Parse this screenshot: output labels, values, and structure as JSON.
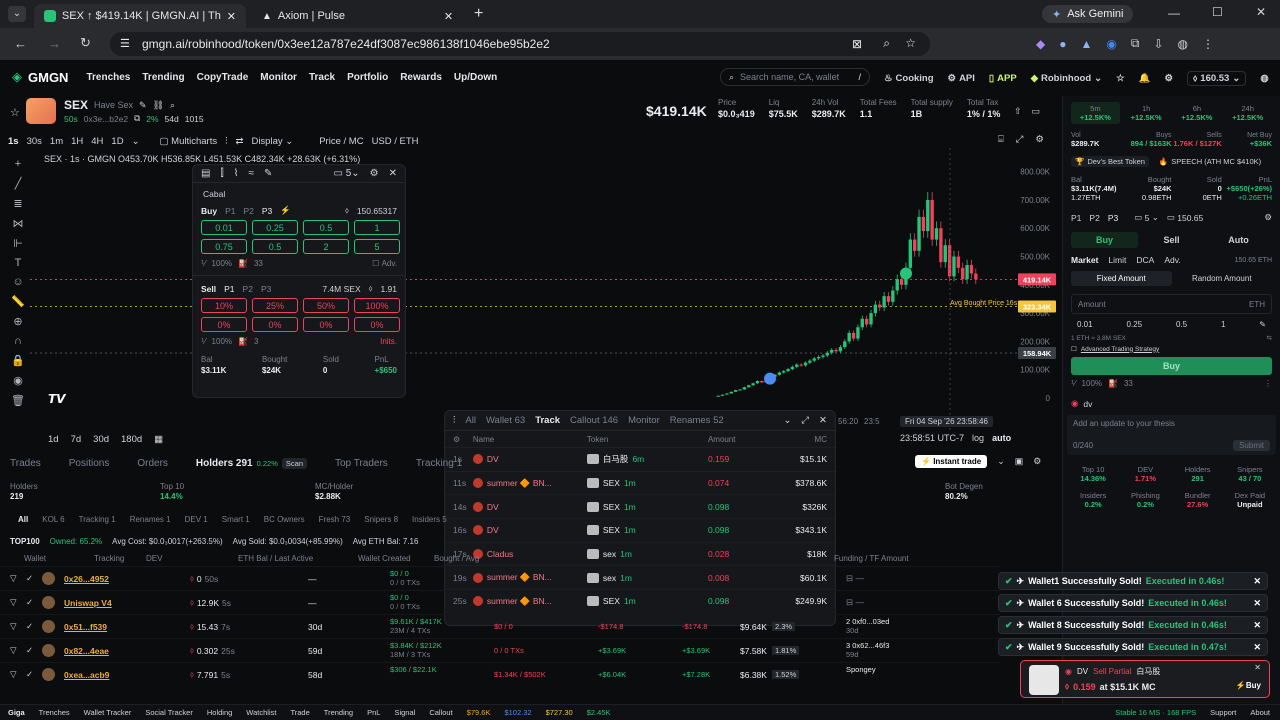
{
  "browser": {
    "tabs": [
      {
        "title": "SEX ↑ $419.14K | GMGN.AI | The"
      },
      {
        "title": "Axiom | Pulse"
      }
    ],
    "ask_gemini": "Ask Gemini",
    "url": "gmgn.ai/robinhood/token/0x3ee12a787e24df3087ec986138f1046ebe95b2e2"
  },
  "nav": {
    "logo": "GMGN",
    "items": [
      "Trenches",
      "Trending",
      "CopyTrade",
      "Monitor",
      "Track",
      "Portfolio",
      "Rewards",
      "Up/Down"
    ],
    "search_placeholder": "Search name, CA, wallet",
    "search_key": "/",
    "cooking": "Cooking",
    "api": "API",
    "app": "APP",
    "chain": "Robinhood",
    "balance": "160.53"
  },
  "token": {
    "symbol": "SEX",
    "name": "Have Sex",
    "age": "50s",
    "addr": "0x3e...b2e2",
    "pct": "2%",
    "days": "54d",
    "holders_ct": "1015",
    "price_big": "$419.14K",
    "stats": [
      {
        "label": "Price",
        "value": "$0.0₃419"
      },
      {
        "label": "Liq",
        "value": "$75.5K"
      },
      {
        "label": "24h Vol",
        "value": "$289.7K"
      },
      {
        "label": "Total Fees",
        "value": "1.1"
      },
      {
        "label": "Total supply",
        "value": "1B"
      },
      {
        "label": "Total Tax",
        "value": "1% / 1%"
      }
    ]
  },
  "chart_toolbar": {
    "intervals": [
      "1s",
      "30s",
      "1m",
      "1H",
      "4H",
      "1D"
    ],
    "multicharts": "Multicharts",
    "display": "Display",
    "price_mc": "Price / MC",
    "usd_eth": "USD / ETH",
    "ohlc": "SEX · 1s · GMGN  O453.70K  H536.85K  L451.53K  C482.34K  +28.63K (+6.31%)",
    "ranges": [
      "1d",
      "7d",
      "30d",
      "180d"
    ],
    "time_readout": "23:58:51 UTC-7",
    "log": "log",
    "auto": "auto",
    "crosshair_time": "Fri 04 Sep '26   23:58:46",
    "x_ticks": [
      "56:20",
      "23:5"
    ],
    "avg_label": "Avg Bought Price 16s"
  },
  "chart_data": {
    "type": "candlestick",
    "y_ticks": [
      "800.00K",
      "700.00K",
      "600.00K",
      "500.00K",
      "400.00K",
      "300.00K",
      "200.00K",
      "100.00K",
      "0"
    ],
    "ylim": [
      0,
      820000
    ],
    "price_tags": [
      {
        "label": "419.14K",
        "value": 419140,
        "color": "#f0425a"
      },
      {
        "label": "323.34K",
        "value": 323340,
        "color": "#f5c542"
      },
      {
        "label": "158.94K",
        "value": 158940,
        "color": "#3a3f48"
      }
    ],
    "candles": [
      [
        5000,
        8000
      ],
      [
        8000,
        12000
      ],
      [
        12000,
        16000
      ],
      [
        16000,
        22000
      ],
      [
        22000,
        28000
      ],
      [
        28000,
        30000
      ],
      [
        30000,
        38000
      ],
      [
        38000,
        45000
      ],
      [
        45000,
        52000
      ],
      [
        52000,
        60000
      ],
      [
        60000,
        55000
      ],
      [
        55000,
        68000
      ],
      [
        68000,
        75000
      ],
      [
        75000,
        82000
      ],
      [
        82000,
        90000
      ],
      [
        90000,
        95000
      ],
      [
        95000,
        102000
      ],
      [
        102000,
        110000
      ],
      [
        110000,
        118000
      ],
      [
        118000,
        115000
      ],
      [
        115000,
        125000
      ],
      [
        125000,
        132000
      ],
      [
        132000,
        140000
      ],
      [
        140000,
        145000
      ],
      [
        145000,
        150000
      ],
      [
        150000,
        160000
      ],
      [
        160000,
        170000
      ],
      [
        170000,
        165000
      ],
      [
        165000,
        180000
      ],
      [
        180000,
        200000
      ],
      [
        200000,
        230000
      ],
      [
        230000,
        210000
      ],
      [
        210000,
        250000
      ],
      [
        250000,
        280000
      ],
      [
        280000,
        260000
      ],
      [
        260000,
        300000
      ],
      [
        300000,
        330000
      ],
      [
        330000,
        320000
      ],
      [
        320000,
        360000
      ],
      [
        360000,
        340000
      ],
      [
        340000,
        380000
      ],
      [
        380000,
        420000
      ],
      [
        420000,
        400000
      ],
      [
        400000,
        460000
      ],
      [
        460000,
        560000
      ],
      [
        560000,
        520000
      ],
      [
        520000,
        640000
      ],
      [
        640000,
        590000
      ],
      [
        590000,
        700000
      ],
      [
        700000,
        560000
      ],
      [
        560000,
        600000
      ],
      [
        600000,
        480000
      ],
      [
        480000,
        540000
      ],
      [
        540000,
        430000
      ],
      [
        430000,
        500000
      ],
      [
        500000,
        460000
      ],
      [
        460000,
        420000
      ],
      [
        420000,
        470000
      ],
      [
        470000,
        440000
      ],
      [
        440000,
        419140
      ]
    ]
  },
  "quick_panel": {
    "title": "Cabal",
    "count": "5",
    "buy": "Buy",
    "presets": [
      "P1",
      "P2",
      "P3"
    ],
    "buy_balance": "150.65317",
    "buy_amounts": [
      "0.01",
      "0.25",
      "0.5",
      "1",
      "0.75",
      "0.5",
      "2",
      "5"
    ],
    "buy_slip": "100%",
    "buy_gas": "33",
    "adv": "Adv.",
    "sell": "Sell",
    "sell_balance": "7.4M SEX",
    "sell_eth": "1.91",
    "sell_pcts": [
      "10%",
      "25%",
      "50%",
      "100%",
      "0%",
      "0%",
      "0%",
      "0%"
    ],
    "sell_slip": "100%",
    "sell_gas": "3",
    "inits": "Inits.",
    "foot": [
      {
        "l": "Bal",
        "v": "$3.11K"
      },
      {
        "l": "Bought",
        "v": "$24K"
      },
      {
        "l": "Sold",
        "v": "0"
      },
      {
        "l": "PnL",
        "v": "+$650"
      }
    ]
  },
  "tracker": {
    "tabs": [
      "All",
      "Wallet 63",
      "Track",
      "Callout 146",
      "Monitor",
      "Renames 52"
    ],
    "cols": [
      "Name",
      "Token",
      "Amount",
      "MC"
    ],
    "rows": [
      {
        "t": "1s",
        "name": "DV",
        "token": "白马股",
        "age": "6m",
        "amt": "0.159",
        "mc": "$15.1K",
        "side": "r"
      },
      {
        "t": "11s",
        "name": "summer 🔶 BN...",
        "token": "SEX",
        "age": "1m",
        "amt": "0.074",
        "mc": "$378.6K",
        "side": "r"
      },
      {
        "t": "14s",
        "name": "DV",
        "token": "SEX",
        "age": "1m",
        "amt": "0.098",
        "mc": "$326K",
        "side": "g"
      },
      {
        "t": "16s",
        "name": "DV",
        "token": "SEX",
        "age": "1m",
        "amt": "0.098",
        "mc": "$343.1K",
        "side": "g"
      },
      {
        "t": "17s",
        "name": "Cladus",
        "token": "sex",
        "age": "1m",
        "amt": "0.028",
        "mc": "$18K",
        "side": "r"
      },
      {
        "t": "19s",
        "name": "summer 🔶 BN...",
        "token": "sex",
        "age": "1m",
        "amt": "0.008",
        "mc": "$60.1K",
        "side": "r"
      },
      {
        "t": "25s",
        "name": "summer 🔶 BN...",
        "token": "SEX",
        "age": "1m",
        "amt": "0.098",
        "mc": "$249.9K",
        "side": "g"
      }
    ]
  },
  "bottom": {
    "tabs": [
      "Trades",
      "Positions",
      "Orders",
      "Holders 291",
      "Top Traders",
      "Tracking 1"
    ],
    "holders_pct": "0.22%",
    "scan": "Scan",
    "instant_trade": "Instant trade",
    "summary": [
      {
        "l": "Holders",
        "v": "219"
      },
      {
        "l": "Top 10",
        "v": "14.4%"
      },
      {
        "l": "MC/Holder",
        "v": "$2.88K"
      },
      {
        "l": "Bot Degen",
        "v": "80.2%"
      }
    ],
    "filters": [
      "All",
      "KOL 6",
      "Tracking 1",
      "Renames 1",
      "DEV 1",
      "Smart 1",
      "BC Owners",
      "Fresh 73",
      "Snipers 8",
      "Insiders 5"
    ],
    "top100": "TOP100",
    "owned": "Owned: 65.2%",
    "avgcost": "Avg Cost: $0.0₃0017(+263.5%)",
    "avgsold": "Avg Sold: $0.0₃0034(+85.99%)",
    "avgethbal": "Avg ETH Bal: 7.16",
    "cols": [
      "Wallet",
      "Tracking",
      "DEV",
      "ETH Bal / Last Active",
      "Wallet Created",
      "Bought / Avg",
      "Funding / TF Amount"
    ],
    "rows": [
      {
        "w": "0x26...4952",
        "bal": "0",
        "ago": "50s",
        "created": "—",
        "b1": "$0 / 0",
        "b2": "0 / 0 TXs"
      },
      {
        "w": "Uniswap V4",
        "bal": "12.9K",
        "ago": "5s",
        "created": "—",
        "b1": "$0 / 0",
        "b2": "0 / 0 TXs"
      },
      {
        "w": "0x51...f539",
        "bal": "15.43",
        "ago": "7s",
        "created": "30d",
        "b1": "$9.61K / $417K",
        "b2": "23M / 4 TXs",
        "c1": "$0 / 0",
        "c2": "-$174.8",
        "c3": "-$174.8",
        "c4": "$9.64K",
        "c5": "2.3%",
        "f": "2 0xf0...03ed",
        "f2": "30d"
      },
      {
        "w": "0x82...4eae",
        "bal": "0.302",
        "ago": "25s",
        "created": "59d",
        "b1": "$3.84K / $212K",
        "b2": "18M / 3 TXs",
        "c1": "0 / 0 TXs",
        "c2": "+$3.69K",
        "c3": "+$3.69K",
        "c4": "$7.58K",
        "c5": "1.81%",
        "f": "3 0x62...46f3",
        "f2": "59d"
      },
      {
        "w": "0xea...acb9",
        "bal": "7.791",
        "ago": "5s",
        "created": "58d",
        "b1": "$306 / $22.1K",
        "b2": "",
        "c1": "$1.34K / $502K",
        "c2": "+$6.04K",
        "c3": "+$7.28K",
        "c4": "$6.38K",
        "c5": "1.52%",
        "f": "Spongey",
        "f2": ""
      }
    ]
  },
  "right": {
    "periods": [
      {
        "l": "5m",
        "v": "+12.5K%"
      },
      {
        "l": "1h",
        "v": "+12.5K%"
      },
      {
        "l": "6h",
        "v": "+12.5K%"
      },
      {
        "l": "24h",
        "v": "+12.5K%"
      }
    ],
    "vol": [
      {
        "l": "Vol",
        "v": "$289.7K"
      },
      {
        "l": "Buys",
        "v": "894 / $163K"
      },
      {
        "l": "Sells",
        "v": "1.76K / $127K"
      },
      {
        "l": "Net Buy",
        "v": "+$36K"
      }
    ],
    "badges": [
      "Dev's Best Token",
      "SPEECH (ATH MC $410K)"
    ],
    "pos": [
      {
        "l": "Bal",
        "v": "$3.11K(7.4M)",
        "v2": "1.27ETH"
      },
      {
        "l": "Bought",
        "v": "$24K",
        "v2": "0.98ETH"
      },
      {
        "l": "Sold",
        "v": "0",
        "v2": "0ETH"
      },
      {
        "l": "PnL",
        "v": "+$650(+26%)",
        "v2": "+0.26ETH"
      }
    ],
    "presets": [
      "P1",
      "P2",
      "P3"
    ],
    "preset_count": "5",
    "eth_bal": "150.65",
    "trade_tabs": [
      "Buy",
      "Sell",
      "Auto"
    ],
    "order_types": [
      "Market",
      "Limit",
      "DCA",
      "Adv."
    ],
    "eth_avail": "150.65 ETH",
    "amt_modes": [
      "Fixed Amount",
      "Random Amount"
    ],
    "amount_label": "Amount",
    "amount_unit": "ETH",
    "quick": [
      "0.01",
      "0.25",
      "0.5",
      "1"
    ],
    "conv": "1 ETH ≈ 3.8M SEX",
    "adv_strategy": "Advanced Trading Strategy",
    "buy_btn": "Buy",
    "slip": "100%",
    "gas": "33",
    "dv": "dv",
    "thesis_placeholder": "Add an update to your thesis",
    "thesis_count": "0/240",
    "thesis_btn": "Submit",
    "metrics": [
      {
        "l": "Top 10",
        "v": "14.36%"
      },
      {
        "l": "DEV",
        "v": "1.71%"
      },
      {
        "l": "Holders",
        "v": "291"
      },
      {
        "l": "Snipers",
        "v": "43 / 70"
      },
      {
        "l": "Insiders",
        "v": "0.2%"
      },
      {
        "l": "Phishing",
        "v": "0.2%"
      },
      {
        "l": "Bundler",
        "v": "27.6%"
      },
      {
        "l": "Dex Paid",
        "v": "Unpaid"
      }
    ]
  },
  "toasts": [
    {
      "w": "Wallet1 Successfully Sold!",
      "t": "Executed in 0.46s!"
    },
    {
      "w": "Wallet 6 Successfully Sold!",
      "t": "Executed in 0.46s!"
    },
    {
      "w": "Wallet 8 Successfully Sold!",
      "t": "Executed in 0.46s!"
    },
    {
      "w": "Wallet 9 Successfully Sold!",
      "t": "Executed in 0.47s!"
    }
  ],
  "notify": {
    "who": "DV",
    "action": "Sell Partial",
    "token": "白马股",
    "amt": "0.159",
    "mc": "at $15.1K MC",
    "buy": "Buy"
  },
  "status": {
    "items": [
      "Giga",
      "Trenches",
      "Wallet Tracker",
      "Social Tracker",
      "Holding",
      "Watchlist",
      "Trade",
      "Trending",
      "PnL",
      "Signal",
      "Callout"
    ],
    "prices": [
      "$79.6K",
      "$102.32",
      "$727.30",
      "$2.45K"
    ],
    "fps": "Stable 16 MS · 168 FPS",
    "support": "Support",
    "about": "About"
  }
}
